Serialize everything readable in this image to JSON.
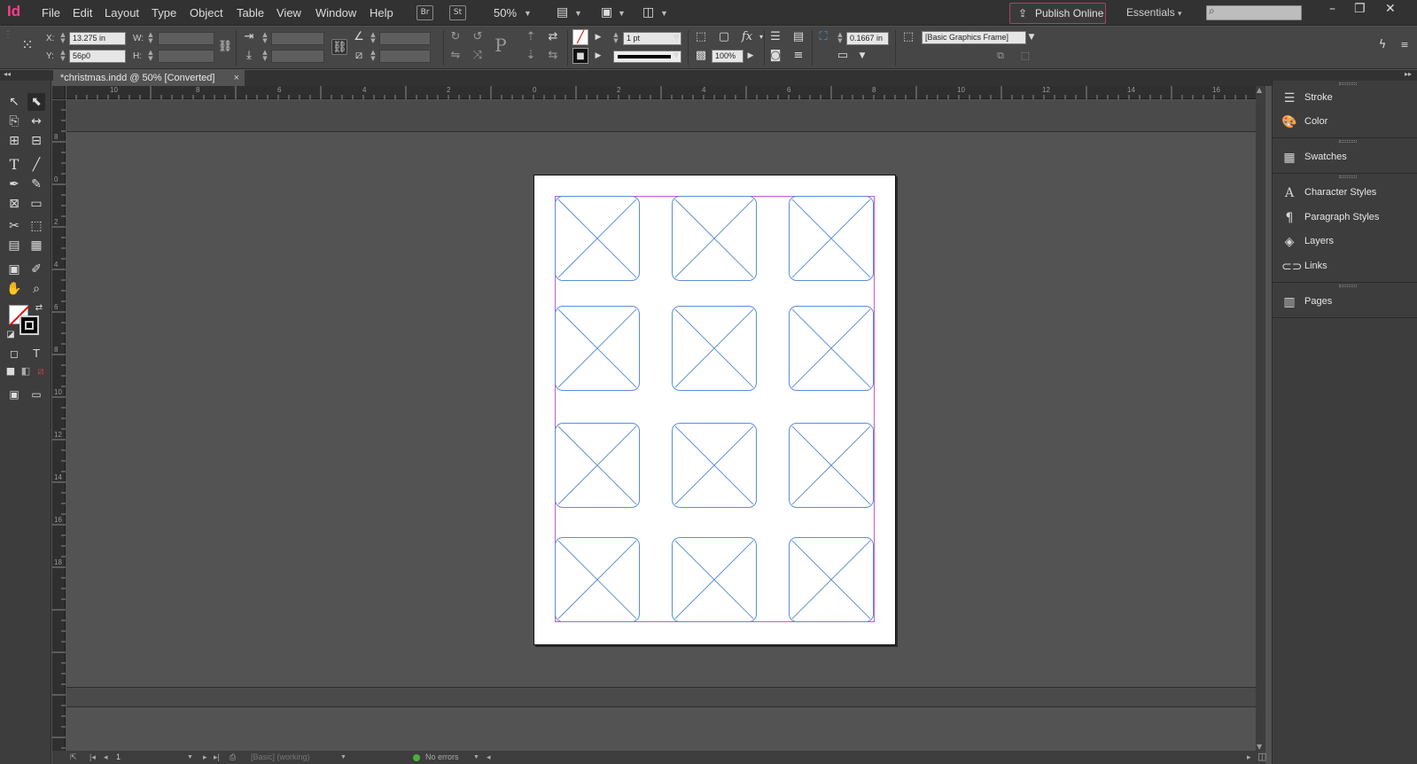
{
  "app": {
    "logo": "Id",
    "menus": [
      "File",
      "Edit",
      "Layout",
      "Type",
      "Object",
      "Table",
      "View",
      "Window",
      "Help"
    ],
    "bridge": "Br",
    "stock": "St",
    "zoom": "50%",
    "publish_label": "Publish Online",
    "workspace": "Essentials",
    "window_controls": [
      "–",
      "❐",
      "✕"
    ]
  },
  "control_panel": {
    "x_label": "X:",
    "x_value": "13.275 in",
    "y_label": "Y:",
    "y_value": "56p0",
    "w_label": "W:",
    "h_label": "H:",
    "stroke_weight": "1 pt",
    "opacity": "100%",
    "offset": "0.1667 in",
    "object_style": "[Basic Graphics Frame]"
  },
  "document": {
    "tab_title": "*christmas.indd @ 50% [Converted]",
    "close": "×"
  },
  "rulers": {
    "h_ticks": [
      "10",
      "8",
      "6",
      "4",
      "2",
      "0",
      "2",
      "4",
      "6",
      "8",
      "10",
      "12",
      "14",
      "16"
    ],
    "v_ticks": [
      "8",
      "0",
      "2",
      "4",
      "6",
      "8",
      "10",
      "12",
      "14",
      "16",
      "18"
    ]
  },
  "status": {
    "page": "1",
    "preflight_profile": "[Basic] (working)",
    "errors": "No errors"
  },
  "panels": [
    {
      "icon": "stroke-icon",
      "label": "Stroke"
    },
    {
      "icon": "color-icon",
      "label": "Color"
    },
    {
      "icon": "swatches-icon",
      "label": "Swatches"
    },
    {
      "icon": "character-styles-icon",
      "label": "Character Styles"
    },
    {
      "icon": "paragraph-styles-icon",
      "label": "Paragraph Styles"
    },
    {
      "icon": "layers-icon",
      "label": "Layers"
    },
    {
      "icon": "links-icon",
      "label": "Links"
    },
    {
      "icon": "pages-icon",
      "label": "Pages"
    }
  ],
  "colors": {
    "accent": "#ff3d8b",
    "frame_stroke": "#5a8fd6",
    "margin_guide": "#c25ccf"
  }
}
